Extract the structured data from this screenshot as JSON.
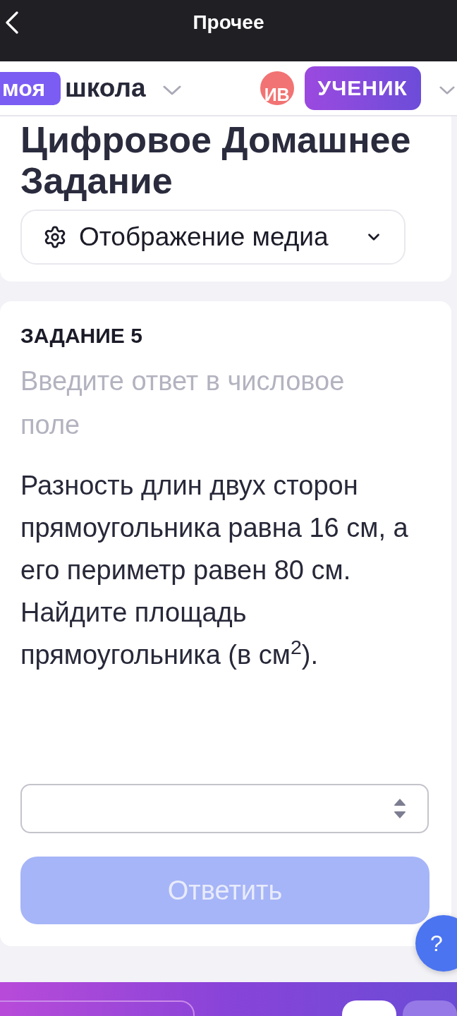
{
  "top_bar": {
    "title": "Прочее"
  },
  "school_bar": {
    "logo_badge": "моя",
    "logo_text": "школа",
    "avatar_initials": "ИВ",
    "role": "УЧЕНИК"
  },
  "homework": {
    "title": "Цифровое Домашнее Задание",
    "media_menu": {
      "label": "Отображение медиа"
    }
  },
  "task": {
    "heading": "ЗАДАНИЕ 5",
    "instruction": "Введите ответ в числовое поле",
    "question": "Разность длин двух сторон прямоугольника равна 16 см, а его периметр равен 80 см. Найдите площадь прямоугольника (в см$^{2}$).",
    "submit": {
      "label": "Ответить",
      "disabled": true
    }
  },
  "help_button": {
    "label": "?"
  }
}
